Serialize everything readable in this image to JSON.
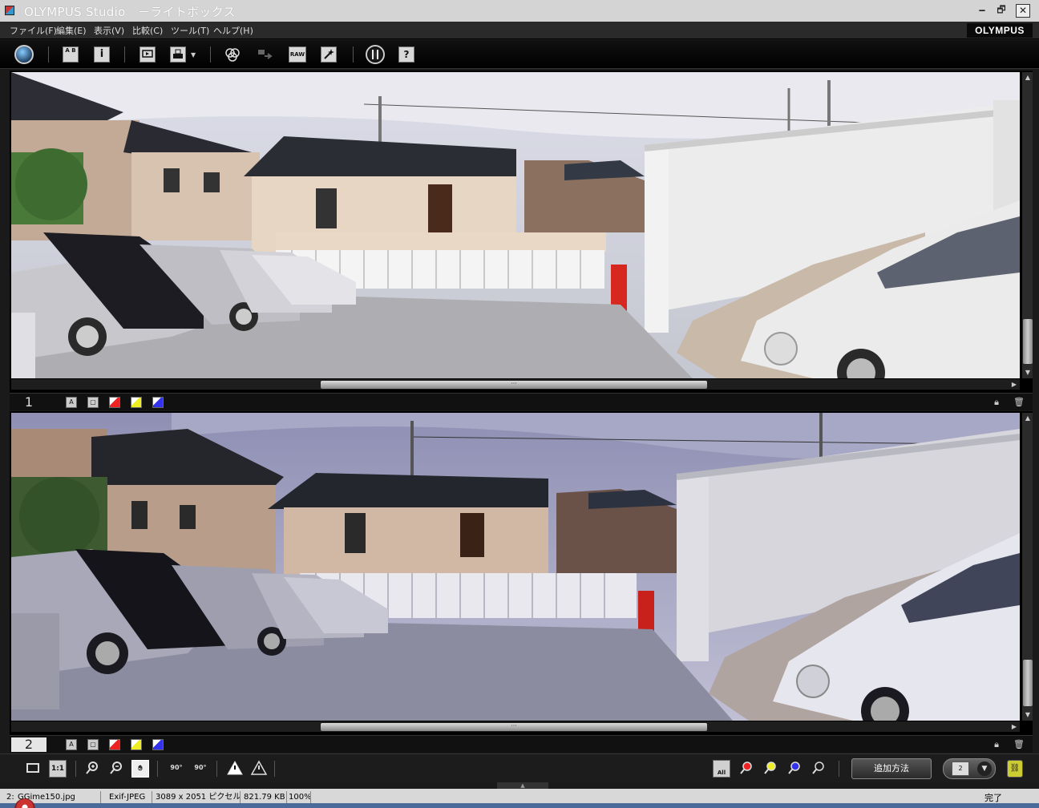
{
  "window": {
    "title": "OLYMPUS Studio　－ライトボックス",
    "minimize": "🗕",
    "restore": "🗗",
    "close": "✕"
  },
  "menu": {
    "items": [
      "ファイル(F)",
      "編集(E)",
      "表示(V)",
      "比較(C)",
      "ツール(T)",
      "ヘルプ(H)"
    ],
    "brand": "OLYMPUS"
  },
  "toolbar": {
    "ab_label": "A B",
    "info_label": "i",
    "raw_label": "RAW",
    "help_label": "?"
  },
  "panels": [
    {
      "number": "1"
    },
    {
      "number": "2"
    }
  ],
  "bottom_toolbar": {
    "fit_label": "1:1",
    "rotate_left_label": "90°",
    "rotate_right_label": "90°",
    "all_label": "All",
    "add_method_label": "追加方法",
    "layout_label": "2"
  },
  "statusbar": {
    "index": "2:",
    "filename": "GGime150.jpg",
    "format": "Exif-JPEG",
    "dimensions": "3089 x 2051 ピクセル",
    "filesize": "821.79 KB",
    "zoom": "100%",
    "status": "完了"
  },
  "colors": {
    "accent_red": "#e22222",
    "accent_yellow": "#eeee22",
    "accent_blue": "#3333ee"
  }
}
